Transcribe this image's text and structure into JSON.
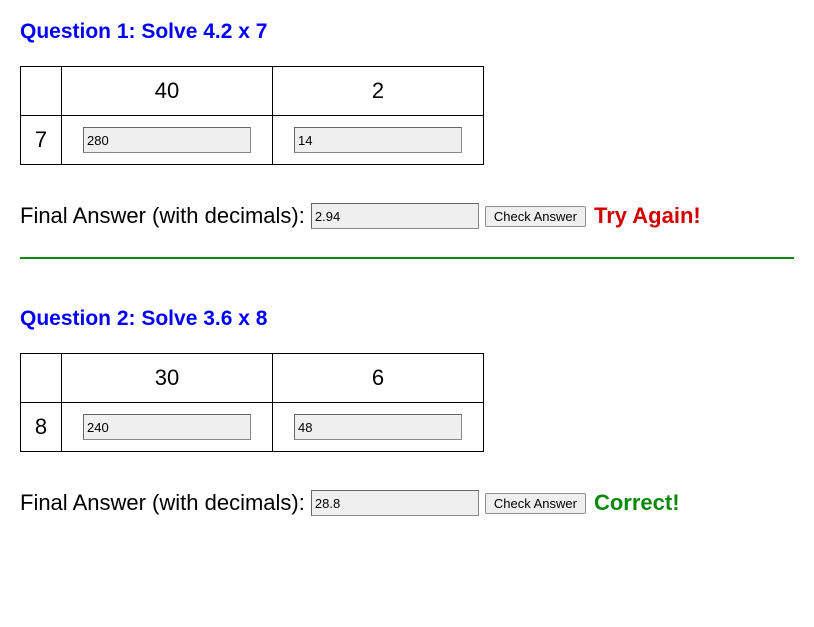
{
  "q1": {
    "title": "Question 1: Solve 4.2 x 7",
    "colA": "40",
    "colB": "2",
    "row": "7",
    "cellA": "280",
    "cellB": "14",
    "answerLabel": "Final Answer (with decimals):",
    "answerValue": "2.94",
    "buttonLabel": "Check Answer",
    "feedback": "Try Again!"
  },
  "q2": {
    "title": "Question 2: Solve 3.6 x 8",
    "colA": "30",
    "colB": "6",
    "row": "8",
    "cellA": "240",
    "cellB": "48",
    "answerLabel": "Final Answer (with decimals):",
    "answerValue": "28.8",
    "buttonLabel": "Check Answer",
    "feedback": "Correct!"
  }
}
